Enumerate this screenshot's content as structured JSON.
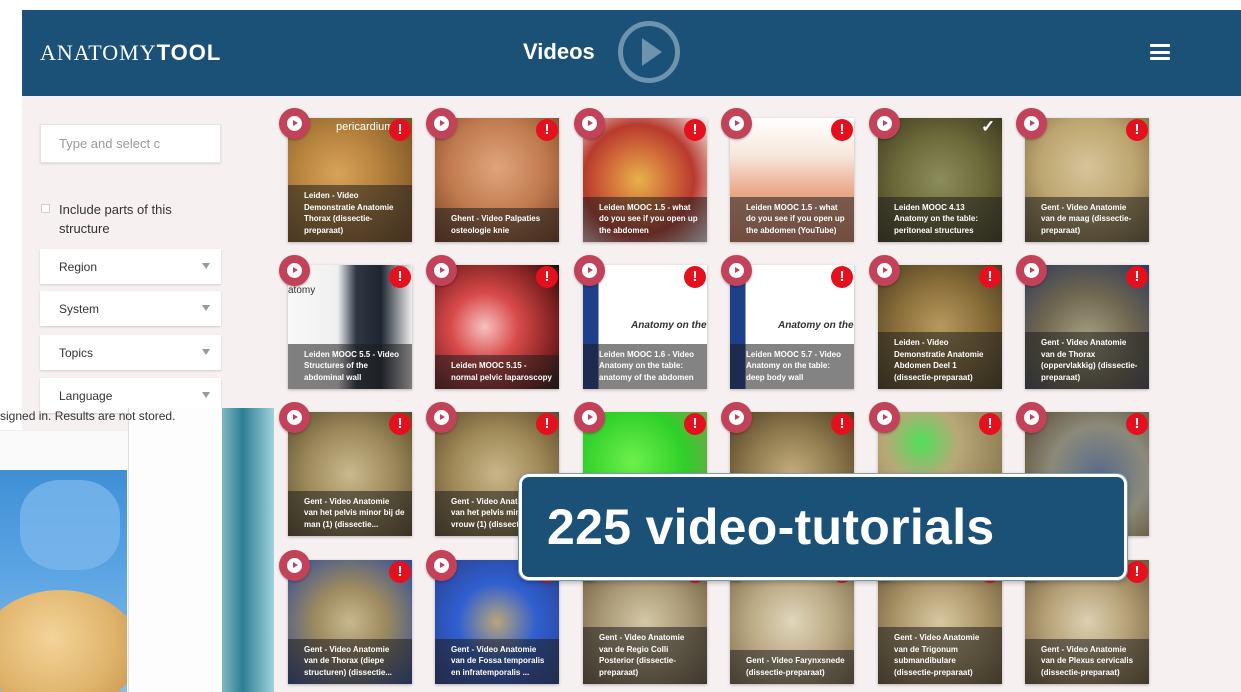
{
  "header": {
    "logo_regular": "ANATOMY",
    "logo_bold": "TOOL",
    "title": "Videos",
    "icons": {
      "play": "play-circle-icon",
      "menu": "hamburger-menu-icon"
    }
  },
  "sidebar": {
    "search_placeholder": "Type and select c",
    "include_label": "Include parts of this structure",
    "filters": [
      "Region",
      "System",
      "Topics",
      "Language"
    ]
  },
  "overlay": {
    "signin_text": "signed in. Results are not stored."
  },
  "banner": {
    "text": "225 video-tutorials"
  },
  "colors": {
    "header": "#1b5176",
    "play_button": "#c2425a",
    "warning": "#e4101d",
    "background": "#f6f0f0"
  },
  "videos": [
    {
      "caption": "Leiden - Video Demonstratie Anatomie Thorax (dissectie-preparaat)",
      "overlay_text": "pericardium",
      "status": "warning"
    },
    {
      "caption": "Ghent - Video Palpaties osteologie knie",
      "status": "warning"
    },
    {
      "caption": "Leiden MOOC 1.5 - what do you see if you open up the abdomen",
      "status": "warning"
    },
    {
      "caption": "Leiden MOOC 1.5 - what do you see if you open up the abdomen (YouTube)",
      "status": "warning"
    },
    {
      "caption": "Leiden MOOC 4.13 Anatomy on the table: peritoneal structures",
      "status": "ok"
    },
    {
      "caption": "Gent - Video Anatomie van de maag (dissectie-preparaat)",
      "status": "warning"
    },
    {
      "caption": "Leiden MOOC 5.5 - Video Structures of the abdominal wall",
      "overlay_text": "atomy",
      "status": "warning"
    },
    {
      "caption": "Leiden MOOC 5.15 - normal pelvic laparoscopy",
      "status": "warning"
    },
    {
      "caption": "Leiden MOOC 1.6 - Video Anatomy on the table: anatomy of the abdomen",
      "overlay_text": "Anatomy on the t",
      "status": "warning"
    },
    {
      "caption": "Leiden MOOC 5.7 - Video Anatomy on the table: deep body wall",
      "overlay_text": "Anatomy on the t",
      "status": "warning"
    },
    {
      "caption": "Leiden - Video Demonstratie Anatomie Abdomen Deel 1 (dissectie-preparaat)",
      "status": "warning"
    },
    {
      "caption": "Gent - Video Anatomie van de Thorax (oppervlakkig) (dissectie-preparaat)",
      "status": "warning"
    },
    {
      "caption": "Gent - Video Anatomie van het pelvis minor bij de man (1) (dissectie...",
      "status": "warning"
    },
    {
      "caption": "Gent - Video Anatomie van het pelvis minor bij de vrouw (1) (dissectie...",
      "status": "warning"
    },
    {
      "caption": "",
      "status": "warning"
    },
    {
      "caption": "",
      "status": "warning"
    },
    {
      "caption": "",
      "status": "warning"
    },
    {
      "caption": "",
      "status": "warning"
    },
    {
      "caption": "Gent - Video Anatomie van de Thorax (diepe structuren) (dissectie...",
      "status": "warning"
    },
    {
      "caption": "Gent - Video Anatomie van de Fossa temporalis en infratemporalis ...",
      "status": "warning"
    },
    {
      "caption": "Gent - Video Anatomie van de Regio Colli Posterior (dissectie-preparaat)",
      "status": "warning"
    },
    {
      "caption": "Gent - Video Farynxsnede (dissectie-preparaat)",
      "status": "warning"
    },
    {
      "caption": "Gent - Video Anatomie van de Trigonum submandibulare (dissectie-preparaat)",
      "status": "warning"
    },
    {
      "caption": "Gent - Video Anatomie van de Plexus cervicalis (dissectie-preparaat)",
      "status": "warning"
    }
  ]
}
